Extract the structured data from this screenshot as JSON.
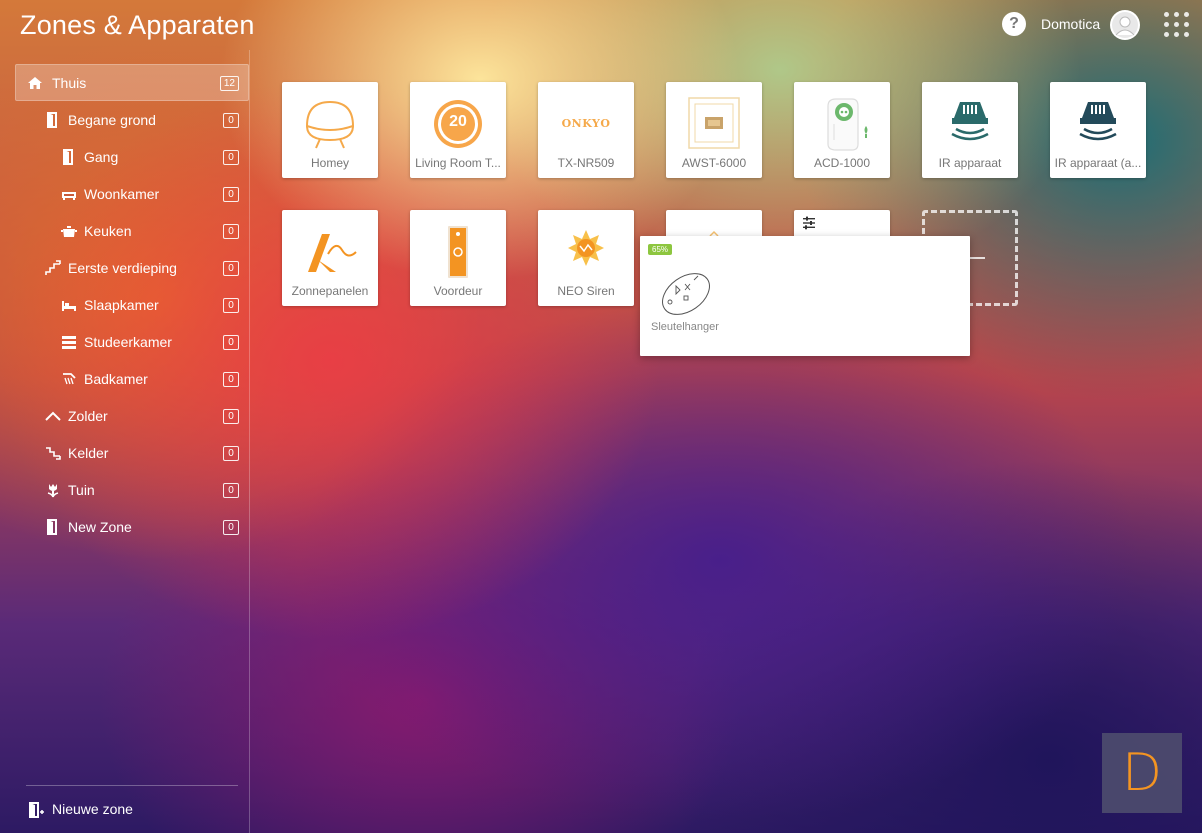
{
  "header": {
    "title": "Zones & Apparaten",
    "help_label": "?",
    "username": "Domotica"
  },
  "sidebar": {
    "zones": [
      {
        "label": "Thuis",
        "count": "12",
        "icon": "home-icon",
        "active": true
      },
      {
        "label": "Begane grond",
        "count": "0",
        "icon": "door-icon"
      },
      {
        "label": "Gang",
        "count": "0",
        "icon": "door-icon"
      },
      {
        "label": "Woonkamer",
        "count": "0",
        "icon": "sofa-icon"
      },
      {
        "label": "Keuken",
        "count": "0",
        "icon": "cooking-pot-icon"
      },
      {
        "label": "Eerste verdieping",
        "count": "0",
        "icon": "stairs-icon"
      },
      {
        "label": "Slaapkamer",
        "count": "0",
        "icon": "bed-icon"
      },
      {
        "label": "Studeerkamer",
        "count": "0",
        "icon": "desk-icon"
      },
      {
        "label": "Badkamer",
        "count": "0",
        "icon": "shower-icon"
      },
      {
        "label": "Zolder",
        "count": "0",
        "icon": "roof-icon"
      },
      {
        "label": "Kelder",
        "count": "0",
        "icon": "stairs-down-icon"
      },
      {
        "label": "Tuin",
        "count": "0",
        "icon": "tulip-icon"
      },
      {
        "label": "New Zone",
        "count": "0",
        "icon": "door-icon"
      }
    ],
    "new_zone_label": "Nieuwe zone"
  },
  "devices": [
    {
      "label": "Homey",
      "icon": "homey-icon"
    },
    {
      "label": "Living Room T...",
      "icon": "thermostat-icon",
      "value": "20"
    },
    {
      "label": "TX-NR509",
      "icon": "onkyo-logo-icon",
      "logo_text": "ONKYO"
    },
    {
      "label": "AWST-6000",
      "icon": "wall-switch-icon"
    },
    {
      "label": "ACD-1000",
      "icon": "plug-dimmer-icon"
    },
    {
      "label": "IR apparaat",
      "icon": "ir-blaster-icon"
    },
    {
      "label": "IR apparaat (a...",
      "icon": "ir-blaster-icon"
    },
    {
      "label": "Zonnepanelen",
      "icon": "solar-icon"
    },
    {
      "label": "Voordeur",
      "icon": "doorbell-icon"
    },
    {
      "label": "NEO Siren",
      "icon": "siren-icon"
    }
  ],
  "popup": {
    "battery": "65%",
    "label": "Sleutelhanger",
    "icon": "keyfob-icon"
  },
  "brand": {
    "letter": "D"
  },
  "colors": {
    "accent": "#f39422",
    "ir_teal": "#2a6a6a",
    "battery_green": "#8dc63f"
  }
}
